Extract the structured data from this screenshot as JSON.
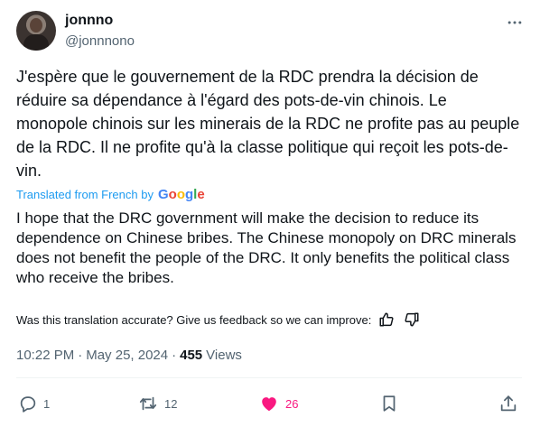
{
  "author": {
    "display_name": "jonnno",
    "handle": "@jonnnono"
  },
  "tweet": {
    "original_text": "J'espère que le gouvernement de la RDC prendra la décision de réduire sa dépendance à l'égard des pots-de-vin chinois. Le monopole chinois sur les minerais de la RDC ne profite pas au peuple de la RDC. Il ne profite qu'à la classe politique qui reçoit les pots-de-vin.",
    "translated_label": "Translated from French by",
    "translated_provider": "Google",
    "translation_text": "I hope that the DRC government will make the decision to reduce its dependence on Chinese bribes. The Chinese monopoly on DRC minerals does not benefit the people of the DRC. It only benefits the political class who receive the bribes.",
    "feedback_prompt": "Was this translation accurate? Give us feedback so we can improve:"
  },
  "meta": {
    "time": "10:22 PM",
    "separator": "·",
    "date": "May 25, 2024",
    "views_count": "455",
    "views_label": "Views"
  },
  "actions": {
    "replies": "1",
    "reposts": "12",
    "likes": "26"
  },
  "colors": {
    "text": "#0f1419",
    "secondary": "#536471",
    "link": "#1d9bf0",
    "like": "#f91880",
    "divider": "#eff3f4"
  },
  "icons": {
    "more": "more-horizontal-icon",
    "thumbs_up": "thumbs-up-icon",
    "thumbs_down": "thumbs-down-icon",
    "reply": "reply-icon",
    "repost": "repost-icon",
    "like": "heart-icon",
    "bookmark": "bookmark-icon",
    "share": "share-icon"
  }
}
